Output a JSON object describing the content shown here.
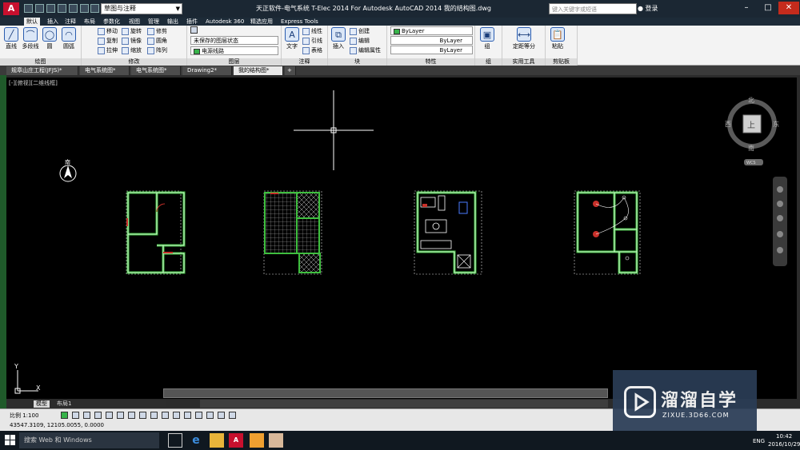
{
  "titlebar": {
    "logo": "A",
    "workspace": "草图与注释",
    "title": "天正软件-电气系统 T-Elec 2014  For Autodesk AutoCAD 2014      我的结构图.dwg",
    "search_placeholder": "键入关键字或短语",
    "login": "登录"
  },
  "ribbon_tabs": [
    "默认",
    "插入",
    "注释",
    "布局",
    "参数化",
    "视图",
    "管理",
    "输出",
    "插件",
    "Autodesk 360",
    "精选应用",
    "Express Tools"
  ],
  "panels": {
    "draw": {
      "title": "绘图",
      "tools": [
        "直线",
        "多段线",
        "圆",
        "圆弧"
      ]
    },
    "modify": {
      "title": "修改",
      "tools": [
        "移动",
        "旋转",
        "修剪",
        "复制",
        "镜像",
        "圆角",
        "拉伸",
        "缩放",
        "阵列"
      ]
    },
    "layers": {
      "title": "图层",
      "state": "未保存的图层状态",
      "current": "电源线路"
    },
    "annotation": {
      "title": "注释",
      "text": "文字",
      "linear": "线性",
      "leader": "引线",
      "table": "表格"
    },
    "block": {
      "title": "块",
      "insert": "插入",
      "create": "创建",
      "edit": "编辑",
      "edit_attr": "编辑属性"
    },
    "properties": {
      "title": "特性",
      "color": "ByLayer",
      "linetype": "ByLayer",
      "lineweight": "ByLayer"
    },
    "groups": {
      "title": "组",
      "group": "组"
    },
    "utilities": {
      "title": "实用工具",
      "measure": "定距等分"
    },
    "clipboard": {
      "title": "剪贴板",
      "paste": "粘贴"
    }
  },
  "file_tabs": [
    "规章山庄工程(JFJS)*",
    "电气系统图*",
    "电气系统图*",
    "Drawing2*",
    "我的结构图*"
  ],
  "viewport": {
    "label": "[-][俯视][二维线框]",
    "north_arrow_label": "南",
    "viewcube": {
      "north": "北",
      "south": "南",
      "east": "东",
      "west": "西",
      "top": "上",
      "wcs": "WCS"
    },
    "ucs_x": "X",
    "ucs_y": "Y"
  },
  "layout_tabs": [
    "模型",
    "布局1"
  ],
  "statusbar": {
    "scale": "比例 1:100",
    "coords": "43547.3109, 12105.0055, 0.0000"
  },
  "watermark": {
    "text": "溜溜自学",
    "url": "ZIXUE.3D66.COM"
  },
  "taskbar": {
    "search": "搜索 Web 和 Windows",
    "lang": "ENG",
    "time": "10:42",
    "date": "2016/10/29"
  },
  "colors": {
    "wall": "#3fbf3f",
    "wall_inner": "#ffffff",
    "door": "#c8302a",
    "dim": "#dcdcdc",
    "hatch": "#c9c9c9",
    "accent": "#c8102e"
  }
}
